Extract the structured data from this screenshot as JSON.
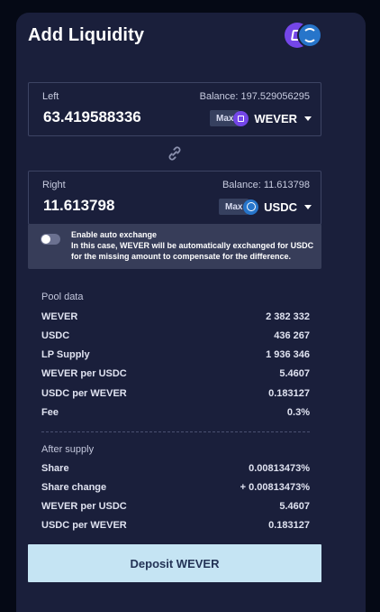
{
  "title": "Add Liquidity",
  "left": {
    "label": "Left",
    "balance": "Balance: 197.529056295",
    "value": "63.419588336",
    "max_label": "Max",
    "token": "WEVER"
  },
  "right": {
    "label": "Right",
    "balance": "Balance: 11.613798",
    "value": "11.613798",
    "max_label": "Max",
    "token": "USDC"
  },
  "auto_exchange": {
    "enabled": false,
    "title": "Enable auto exchange",
    "description": "In this case, WEVER will be automatically exchanged for USDC for the missing amount to compensate for the difference."
  },
  "pool_data": {
    "title": "Pool data",
    "rows": [
      {
        "key": "WEVER",
        "value": "2 382 332"
      },
      {
        "key": "USDC",
        "value": "436 267"
      },
      {
        "key": "LP Supply",
        "value": "1 936 346"
      },
      {
        "key": "WEVER per USDC",
        "value": "5.4607"
      },
      {
        "key": "USDC per WEVER",
        "value": "0.183127"
      },
      {
        "key": "Fee",
        "value": "0.3%"
      }
    ]
  },
  "after_supply": {
    "title": "After supply",
    "rows": [
      {
        "key": "Share",
        "value": "0.00813473%"
      },
      {
        "key": "Share change",
        "value": "+ 0.00813473%"
      },
      {
        "key": "WEVER per USDC",
        "value": "5.4607"
      },
      {
        "key": "USDC per WEVER",
        "value": "0.183127"
      }
    ]
  },
  "deposit_label": "Deposit WEVER",
  "colors": {
    "background": "#050915",
    "card": "#1a1f3b",
    "accent_button": "#c5e4f3",
    "wever": "#7446e8",
    "usdc": "#2775ca"
  }
}
